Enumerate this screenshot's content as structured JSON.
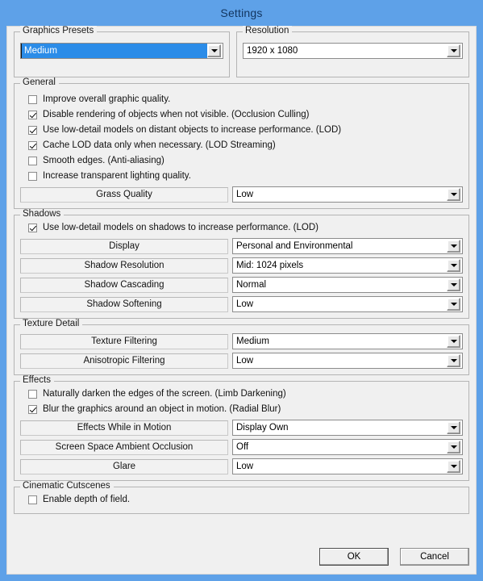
{
  "window": {
    "title": "Settings"
  },
  "presets": {
    "legend": "Graphics Presets",
    "value": "Medium"
  },
  "resolution": {
    "legend": "Resolution",
    "value": "1920 x 1080"
  },
  "general": {
    "legend": "General",
    "checks": [
      {
        "label": "Improve overall graphic quality.",
        "checked": false
      },
      {
        "label": "Disable rendering of objects when not visible. (Occlusion Culling)",
        "checked": true
      },
      {
        "label": "Use low-detail models on distant objects to increase performance. (LOD)",
        "checked": true
      },
      {
        "label": "Cache LOD data only when necessary. (LOD Streaming)",
        "checked": true
      },
      {
        "label": "Smooth edges. (Anti-aliasing)",
        "checked": false
      },
      {
        "label": "Increase transparent lighting quality.",
        "checked": false
      }
    ],
    "rows": [
      {
        "label": "Grass Quality",
        "value": "Low"
      }
    ]
  },
  "shadows": {
    "legend": "Shadows",
    "checks": [
      {
        "label": "Use low-detail models on shadows to increase performance. (LOD)",
        "checked": true
      }
    ],
    "rows": [
      {
        "label": "Display",
        "value": "Personal and Environmental"
      },
      {
        "label": "Shadow Resolution",
        "value": "Mid: 1024 pixels"
      },
      {
        "label": "Shadow Cascading",
        "value": "Normal"
      },
      {
        "label": "Shadow Softening",
        "value": "Low"
      }
    ]
  },
  "texture_detail": {
    "legend": "Texture Detail",
    "rows": [
      {
        "label": "Texture Filtering",
        "value": "Medium"
      },
      {
        "label": "Anisotropic Filtering",
        "value": "Low"
      }
    ]
  },
  "effects": {
    "legend": "Effects",
    "checks": [
      {
        "label": "Naturally darken the edges of the screen. (Limb Darkening)",
        "checked": false
      },
      {
        "label": "Blur the graphics around an object in motion. (Radial Blur)",
        "checked": true
      }
    ],
    "rows": [
      {
        "label": "Effects While in Motion",
        "value": "Display Own"
      },
      {
        "label": "Screen Space Ambient Occlusion",
        "value": "Off"
      },
      {
        "label": "Glare",
        "value": "Low"
      }
    ]
  },
  "cinematic": {
    "legend": "Cinematic Cutscenes",
    "checks": [
      {
        "label": "Enable depth of field.",
        "checked": false
      }
    ]
  },
  "footer": {
    "ok_label": "OK",
    "cancel_label": "Cancel"
  },
  "colors": {
    "frame_blue": "#5ea1e8",
    "selection_blue": "#2b8ce8",
    "dialog_bg": "#f0f0f0",
    "title_text": "#12355f"
  }
}
